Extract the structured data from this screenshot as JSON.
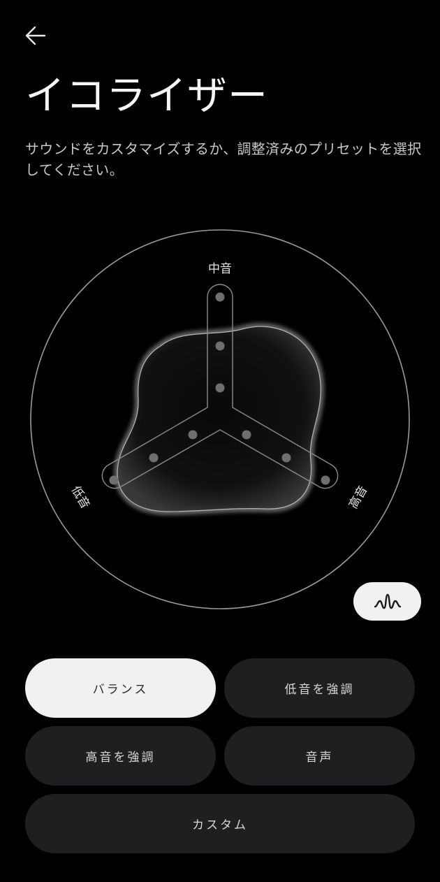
{
  "header": {
    "back_icon": "arrow-left-icon",
    "title": "イコライザー",
    "subtitle": "サウンドをカスタマイズするか、調整済みのプリセットを選択してください。"
  },
  "equalizer": {
    "labels": {
      "mid": "中音",
      "low": "低音",
      "high": "高音"
    },
    "wave_button_icon": "waveform-icon"
  },
  "presets": [
    {
      "label": "バランス",
      "active": true
    },
    {
      "label": "低音を強調",
      "active": false
    },
    {
      "label": "高音を強調",
      "active": false
    },
    {
      "label": "音声",
      "active": false
    },
    {
      "label": "カスタム",
      "active": false
    }
  ],
  "colors": {
    "background": "#000000",
    "chip_active": "#f0f1f1",
    "chip_inactive": "#1e1f21",
    "text_primary": "#f5f5f5",
    "text_secondary": "#c9c9c9"
  }
}
